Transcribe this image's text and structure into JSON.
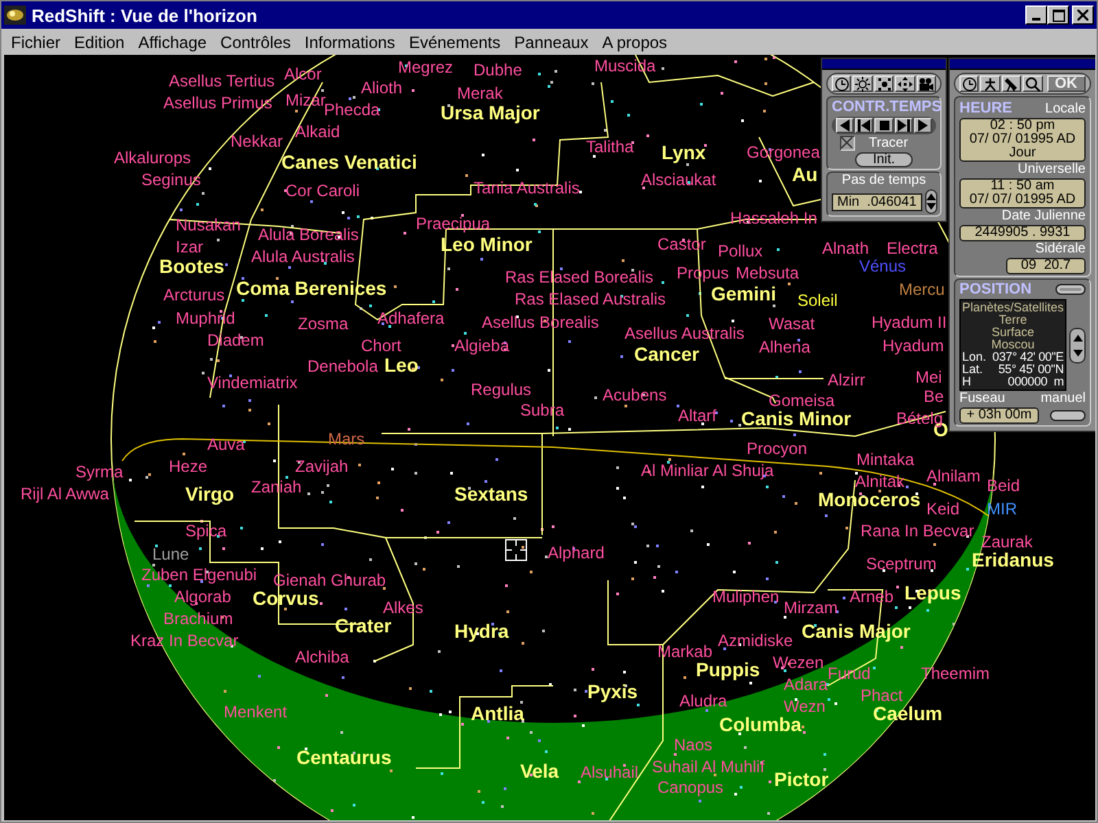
{
  "window": {
    "title": "RedShift : Vue de l'horizon"
  },
  "menu": [
    "Fichier",
    "Edition",
    "Affichage",
    "Contrôles",
    "Informations",
    "Evénements",
    "Panneaux",
    "A propos"
  ],
  "sky_map": {
    "constellations": [
      "Ursa Major",
      "Canes Venatici",
      "Lynx",
      "Au",
      "Leo Minor",
      "Bootes",
      "Coma Berenices",
      "Gemini",
      "Leo",
      "Cancer",
      "Canis Minor",
      "O",
      "Virgo",
      "Sextans",
      "Monoceros",
      "Eridanus",
      "Corvus",
      "Lepus",
      "Crater",
      "Hydra",
      "Canis Major",
      "Puppis",
      "Pyxis",
      "Antlia",
      "Columba",
      "Caelum",
      "Centaurus",
      "Vela",
      "Pictor"
    ],
    "stars": [
      "Megrez",
      "Dubhe",
      "Muscida",
      "Alcor",
      "Asellus Tertius",
      "Alioth",
      "Merak",
      "Asellus Primus",
      "Mizar",
      "Phecda",
      "Alkaid",
      "Nekkar",
      "Talitha",
      "Alkalurops",
      "Gorgonea",
      "Seginus",
      "Alsciaukat",
      "Cor Caroli",
      "Tania Australis",
      "Hassaleh In",
      "Nusakan",
      "Praecipua",
      "Alula Borealis",
      "Izar",
      "Castor",
      "Pollux",
      "Alnath",
      "Electra",
      "Alula Australis",
      "Ras Elased Borealis",
      "Propus",
      "Mebsuta",
      "Arcturus",
      "Ras Elased Australis",
      "Muphrid",
      "Zosma",
      "Adhafera",
      "Asellus Borealis",
      "Wasat",
      "Hyadum II",
      "Asellus Australis",
      "Diadem",
      "Chort",
      "Algieba",
      "Alhena",
      "Hyadum",
      "Denebola",
      "Vindemiatrix",
      "Alzirr",
      "Mei",
      "Regulus",
      "Acubens",
      "Gomeisa",
      "Be",
      "Subra",
      "Altarf",
      "Bételg",
      "Auva",
      "Procyon",
      "Syrma",
      "Heze",
      "Zavijah",
      "Al Minliar Al Shuja",
      "Mintaka",
      "Rijl Al Awwa",
      "Zaniah",
      "Alnitak",
      "Alnilam",
      "Beid",
      "Keid",
      "Spica",
      "Rana In Becvar",
      "Zaurak",
      "Alphard",
      "Sceptrum",
      "Zuben Elgenubi",
      "Gienah Ghurab",
      "Algorab",
      "Muliphen",
      "Arneb",
      "Alkes",
      "Mirzam",
      "Brachium",
      "Kraz In Becvar",
      "Azmidiske",
      "Alchiba",
      "Markab",
      "Wezen",
      "Furud",
      "Theemim",
      "Adara",
      "Aludra",
      "Phact",
      "Menkent",
      "Wezn",
      "Naos",
      "Alsuhail",
      "Suhail Al Muhlif",
      "Canopus"
    ],
    "planets": [
      {
        "name": "Mars",
        "color": "#d06848"
      },
      {
        "name": "Soleil",
        "color": "#ffff40"
      },
      {
        "name": "Vénus",
        "color": "#5050ff"
      },
      {
        "name": "Mercu",
        "color": "#c08040"
      },
      {
        "name": "Lune",
        "color": "#a0a0a0"
      },
      {
        "name": "MIR",
        "color": "#4090ff"
      }
    ]
  },
  "time_panel": {
    "title": "CONTR.TEMPS",
    "trace": {
      "label": "Tracer",
      "checked": true
    },
    "init_button": "Init.",
    "step_label": "Pas de temps",
    "step_value": "Min  .046041"
  },
  "clock_panel": {
    "ok_button": {
      "label": "OK",
      "disabled": true
    },
    "title": "HEURE",
    "local_label": "Locale",
    "local_time": "02 : 50 pm",
    "local_date": "07/ 07/ 01995 AD",
    "day_night": "Jour",
    "ut_label": "Universelle",
    "ut_time": "11 : 50 am",
    "ut_date": "07/ 07/ 01995 AD",
    "julian_label": "Date Julienne",
    "julian_value": "2449905 . 9931",
    "sidereal_label": "Sidérale",
    "sidereal_value": "09  20.7"
  },
  "position_panel": {
    "title": "POSITION",
    "lines": [
      "Planètes/Satellites",
      "Terre",
      "Surface",
      "Moscou"
    ],
    "coords": [
      {
        "label": "Lon.",
        "value": "037° 42' 00\"E"
      },
      {
        "label": "Lat.",
        "value": "55° 45' 00\"N"
      },
      {
        "label": "H",
        "value": "000000  m"
      }
    ],
    "zone_label": "Fuseau",
    "manual_label": "manuel",
    "zone_value": "+ 03h 00m"
  }
}
